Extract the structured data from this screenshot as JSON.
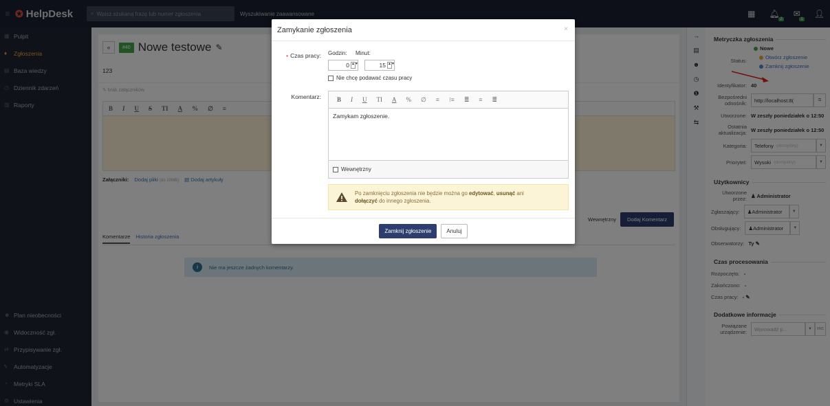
{
  "header": {
    "brand": "HelpDesk",
    "search_placeholder": "Wpisz szukaną frazę lub numer zgłoszenia",
    "advanced_search": "Wyszukiwanie zaawansowane",
    "badge_1": "2",
    "badge_2": "1"
  },
  "sidebar": {
    "items": [
      {
        "label": "Pulpit",
        "icon": "dashboard-icon"
      },
      {
        "label": "Zgłoszenia",
        "icon": "fire-icon"
      },
      {
        "label": "Baza wiedzy",
        "icon": "book-icon"
      },
      {
        "label": "Dziennik zdarzeń",
        "icon": "clock-icon"
      },
      {
        "label": "Raporty",
        "icon": "report-icon"
      }
    ],
    "bottom_items": [
      {
        "label": "Plan nieobecności"
      },
      {
        "label": "Widoczność zgł."
      },
      {
        "label": "Przypisywanie zgł."
      },
      {
        "label": "Automatyzacje"
      },
      {
        "label": "Metryki SLA"
      },
      {
        "label": "Ustawienia"
      }
    ]
  },
  "ticket": {
    "number": "#40",
    "title": "Nowe testowe",
    "description": "123",
    "no_attachments": "brak załączników",
    "attachments_label": "Załączniki:",
    "add_files": "Dodaj pliki",
    "file_limit": "(do 20MB)",
    "add_articles": "Dodaj artykuły",
    "internal_label": "Wewnętrzny",
    "add_comment": "Dodaj Komentarz",
    "tab_comments": "Komentarze",
    "tab_history": "Historia zgłoszenia",
    "no_comments": "Nie ma jeszcze żadnych komentarzy."
  },
  "modal": {
    "title": "Zamykanie zgłoszenia",
    "work_time_label": "Czas pracy:",
    "hours_label": "Godzin:",
    "minutes_label": "Minut:",
    "hours_value": "0",
    "minutes_value": "15",
    "no_time_label": "Nie chcę podawać czasu pracy",
    "comment_label": "Komentarz:",
    "comment_text": "Zamykam zgłoszenie.",
    "internal_label": "Wewnętrzny",
    "warn_part1": "Po zamknięciu zgłoszenia nie będzie można go ",
    "warn_edit": "edytować",
    "warn_sep": ", ",
    "warn_delete": "usunąć",
    "warn_part2": " ani ",
    "warn_attach": "dołączyć",
    "warn_part3": " do innego zgłoszenia.",
    "close_button": "Zamknij zgłoszenie",
    "cancel_button": "Anuluj"
  },
  "right_panel": {
    "metrics_title": "Metryczka zgłoszenia",
    "status_label": "Status:",
    "status_current": "Nowe",
    "status_open": "Otwórz zgłoszenie",
    "status_close": "Zamknij zgłoszenie",
    "id_label": "Identyfikator:",
    "id_value": "40",
    "link_label": "Bezpośredni odnośnik:",
    "link_value": "http://localhost:8(",
    "created_label": "Utworzone:",
    "created_value": "W zeszły poniedziałek o 12:50",
    "updated_label": "Ostatnia aktualizacja:",
    "updated_value": "W zeszły poniedziałek o 12:50",
    "category_label": "Kategoria:",
    "category_value": "Telefony",
    "category_default": "(domyślny)",
    "priority_label": "Priorytet:",
    "priority_value": "Wysoki",
    "priority_default": "(domyślny)",
    "users_title": "Użytkownicy",
    "created_by_label": "Utworzone przez:",
    "created_by_value": "Administrator",
    "reporter_label": "Zgłaszający:",
    "reporter_value": "Administrator",
    "handler_label": "Obsługujący:",
    "handler_value": "Administrator",
    "observers_label": "Obserwatorzy:",
    "observers_value": "Ty",
    "processing_title": "Czas procesowania",
    "started_label": "Rozpoczęto:",
    "started_value": "-",
    "finished_label": "Zakończono:",
    "finished_value": "-",
    "worktime_label": "Czas pracy:",
    "worktime_value": "-",
    "additional_title": "Dodatkowe informacje",
    "device_label": "Powiązane urządzenie:",
    "device_placeholder": "Wprowadź p...",
    "vnc": "VNC"
  },
  "colors": {
    "accent": "#2d3e6e",
    "active_nav": "#f0a53a",
    "ticket_badge": "#46a64b",
    "status_new": "#46a64b",
    "status_open": "#f0a53a",
    "status_close": "#4a8fd0"
  }
}
